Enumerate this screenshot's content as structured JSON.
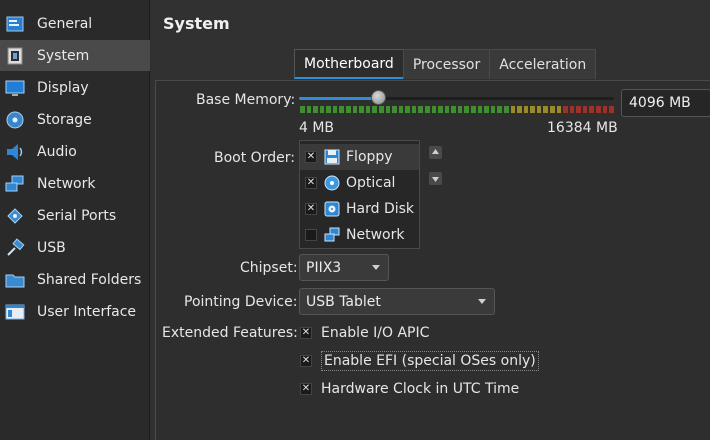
{
  "sidebar": {
    "items": [
      {
        "label": "General",
        "icon": "general-icon"
      },
      {
        "label": "System",
        "icon": "system-icon"
      },
      {
        "label": "Display",
        "icon": "display-icon"
      },
      {
        "label": "Storage",
        "icon": "storage-icon"
      },
      {
        "label": "Audio",
        "icon": "audio-icon"
      },
      {
        "label": "Network",
        "icon": "network-icon"
      },
      {
        "label": "Serial Ports",
        "icon": "serial-ports-icon"
      },
      {
        "label": "USB",
        "icon": "usb-icon"
      },
      {
        "label": "Shared Folders",
        "icon": "shared-folders-icon"
      },
      {
        "label": "User Interface",
        "icon": "user-interface-icon"
      }
    ],
    "selected": "System"
  },
  "page": {
    "title": "System"
  },
  "tabs": [
    {
      "label": "Motherboard",
      "active": true
    },
    {
      "label": "Processor",
      "active": false
    },
    {
      "label": "Acceleration",
      "active": false
    }
  ],
  "memory": {
    "label": "Base Memory:",
    "min_label": "4 MB",
    "max_label": "16384 MB",
    "value": "4096 MB",
    "min": 4,
    "max": 16384,
    "current": 4096
  },
  "boot": {
    "label": "Boot Order:",
    "items": [
      {
        "label": "Floppy",
        "checked": true,
        "icon": "floppy-icon"
      },
      {
        "label": "Optical",
        "checked": true,
        "icon": "optical-disc-icon"
      },
      {
        "label": "Hard Disk",
        "checked": true,
        "icon": "hard-disk-icon"
      },
      {
        "label": "Network",
        "checked": false,
        "icon": "network-icon"
      }
    ]
  },
  "chipset": {
    "label": "Chipset:",
    "value": "PIIX3"
  },
  "pointing": {
    "label": "Pointing Device:",
    "value": "USB Tablet"
  },
  "extended": {
    "label": "Extended Features:",
    "options": [
      {
        "label": "Enable I/O APIC",
        "checked": true
      },
      {
        "label": "Enable EFI (special OSes only)",
        "checked": true
      },
      {
        "label": "Hardware Clock in UTC Time",
        "checked": true
      }
    ]
  },
  "colors": {
    "accent": "#2e8ed6",
    "selected_bg": "#4a4a4a"
  }
}
